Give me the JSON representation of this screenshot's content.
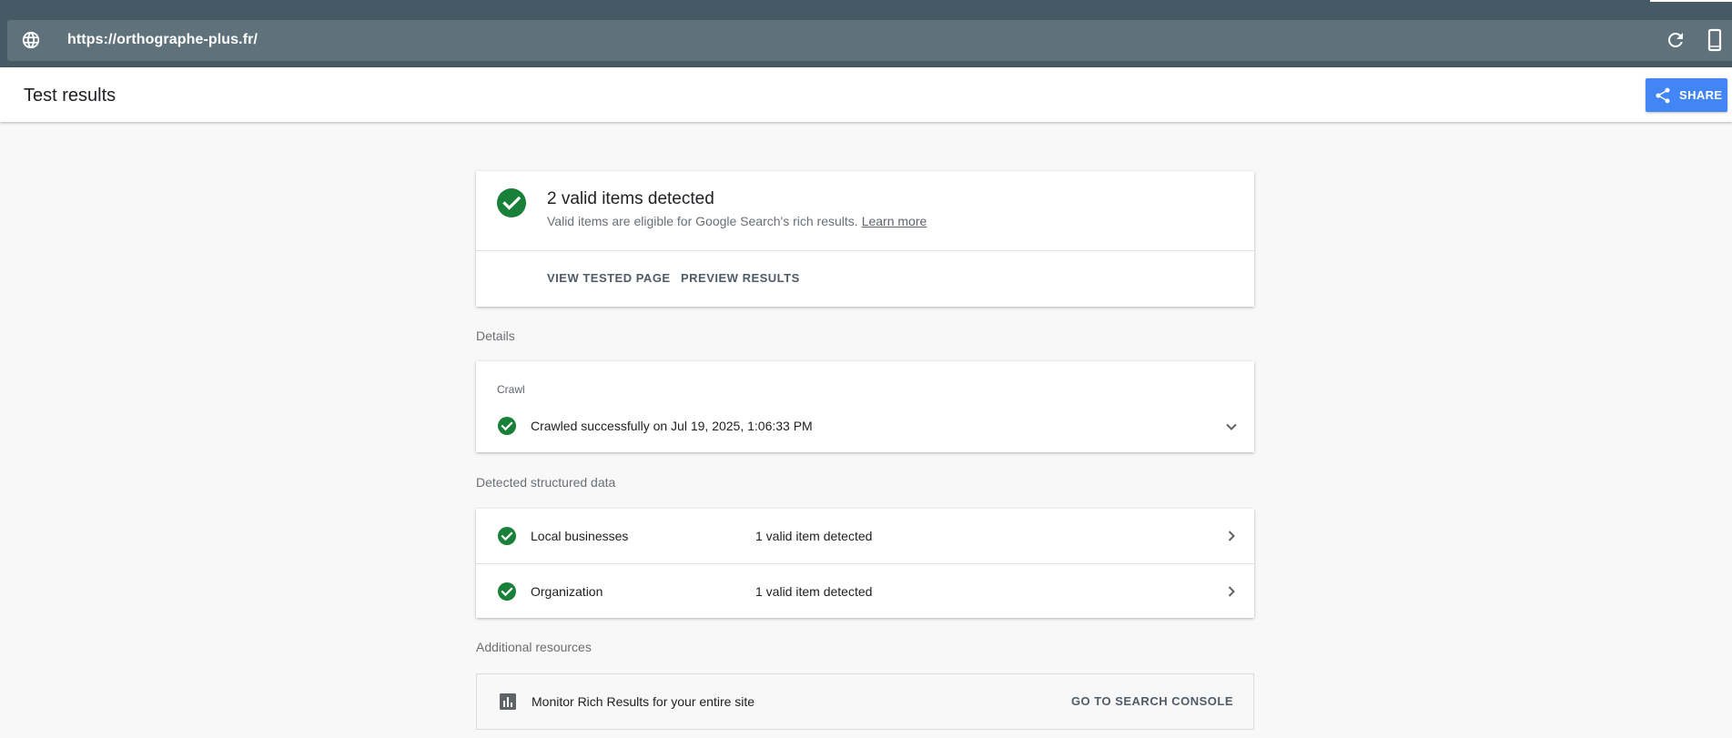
{
  "browser": {
    "url": "https://orthographe-plus.fr/"
  },
  "header": {
    "title": "Test results",
    "share_label": "SHARE"
  },
  "summary": {
    "title": "2 valid items detected",
    "subtitle": "Valid items are eligible for Google Search's rich results.",
    "learn_more": "Learn more",
    "view_tested_page": "VIEW TESTED PAGE",
    "preview_results": "PREVIEW RESULTS"
  },
  "details": {
    "section_label": "Details",
    "crawl_label": "Crawl",
    "crawl_status": "Crawled successfully on Jul 19, 2025, 1:06:33 PM"
  },
  "structured_data": {
    "section_label": "Detected structured data",
    "rows": [
      {
        "name": "Local businesses",
        "status": "1 valid item detected"
      },
      {
        "name": "Organization",
        "status": "1 valid item detected"
      }
    ]
  },
  "resources": {
    "section_label": "Additional resources",
    "text": "Monitor Rich Results for your entire site",
    "action": "GO TO SEARCH CONSOLE"
  },
  "icons": {
    "globe": "globe-icon",
    "reload": "reload-icon",
    "mobile": "mobile-device-icon",
    "share": "share-icon",
    "valid": "check-circle-icon",
    "expand": "chevron-down-icon",
    "open": "chevron-right-icon",
    "chart": "bar-chart-icon"
  },
  "colors": {
    "topbar": "#455a64",
    "urlbar": "#5f727c",
    "accent": "#4285f4",
    "valid_green": "#188038"
  }
}
